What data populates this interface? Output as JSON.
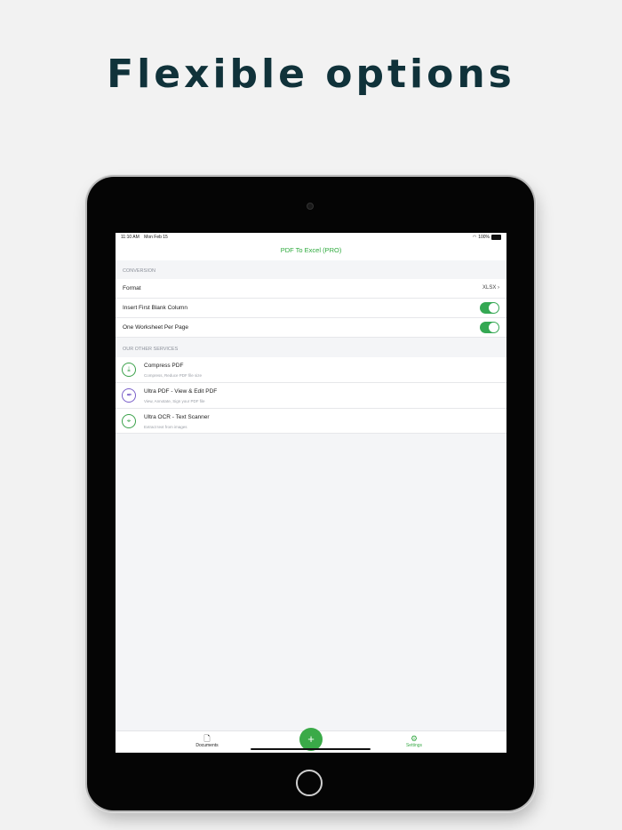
{
  "headline": "Flexible options",
  "status_bar": {
    "time": "11:10 AM",
    "date": "Mon Feb 15",
    "battery": "100%"
  },
  "nav": {
    "title": "PDF To Excel (PRO)"
  },
  "conversion": {
    "header": "CONVERSION",
    "format_label": "Format",
    "format_value": "XLSX",
    "insert_blank_label": "Insert First Blank Column",
    "insert_blank_on": true,
    "one_sheet_label": "One Worksheet Per Page",
    "one_sheet_on": true
  },
  "services": {
    "header": "OUR OTHER SERVICES",
    "items": [
      {
        "title": "Compress PDF",
        "subtitle": "Compress, Reduce PDF file size",
        "icon": "compress-icon",
        "color": "#3aa14a"
      },
      {
        "title": "Ultra PDF - View & Edit PDF",
        "subtitle": "View, Annotate, Sign your PDF file",
        "icon": "signature-icon",
        "color": "#7a5fc9"
      },
      {
        "title": "Ultra OCR - Text Scanner",
        "subtitle": "Extract text from images",
        "icon": "scanner-icon",
        "color": "#3aa14a"
      }
    ]
  },
  "tabs": {
    "documents": "Documents",
    "settings": "Settings"
  },
  "accent": "#34a853"
}
